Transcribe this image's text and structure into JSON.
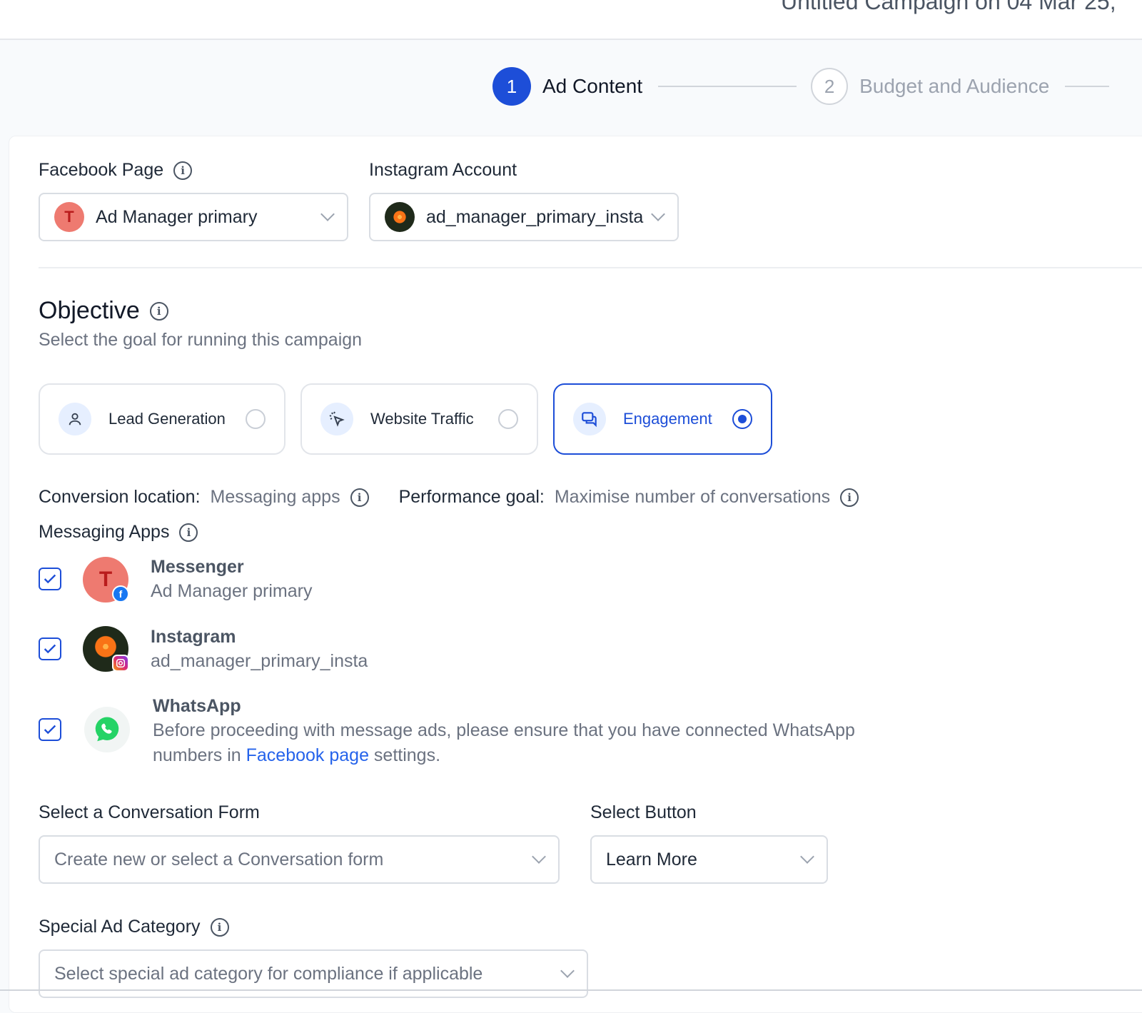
{
  "header": {
    "campaign_title": "Untitled Campaign on 04 Mar 25, "
  },
  "stepper": {
    "steps": [
      {
        "number": "1",
        "label": "Ad Content",
        "state": "active"
      },
      {
        "number": "2",
        "label": "Budget and Audience",
        "state": "inactive"
      }
    ]
  },
  "facebook_page": {
    "label": "Facebook Page",
    "avatar_letter": "T",
    "value": "Ad Manager primary"
  },
  "instagram_account": {
    "label": "Instagram Account",
    "value": "ad_manager_primary_insta"
  },
  "objective": {
    "title": "Objective",
    "subtitle": "Select the goal for running this campaign",
    "options": [
      {
        "label": "Lead Generation",
        "icon": "user-icon",
        "selected": false
      },
      {
        "label": "Website Traffic",
        "icon": "cursor-click-icon",
        "selected": false
      },
      {
        "label": "Engagement",
        "icon": "chat-bubbles-icon",
        "selected": true
      }
    ]
  },
  "conversion": {
    "location_label": "Conversion location:",
    "location_value": "Messaging apps",
    "goal_label": "Performance goal:",
    "goal_value": "Maximise number of conversations"
  },
  "messaging_apps": {
    "label": "Messaging Apps",
    "apps": [
      {
        "name": "Messenger",
        "subtitle": "Ad Manager primary",
        "avatar_letter": "T",
        "checked": true
      },
      {
        "name": "Instagram",
        "subtitle": "ad_manager_primary_insta",
        "checked": true
      },
      {
        "name": "WhatsApp",
        "subtitle_part1": "Before proceeding with message ads, please ensure that you have connected WhatsApp",
        "subtitle_part2": "numbers in ",
        "link_text": "Facebook page",
        "subtitle_part3": " settings.",
        "checked": true
      }
    ]
  },
  "conversation_form": {
    "label": "Select a Conversation Form",
    "placeholder": "Create new or select a Conversation form"
  },
  "select_button": {
    "label": "Select Button",
    "value": "Learn More"
  },
  "special_ad_category": {
    "label": "Special Ad Category",
    "placeholder": "Select special ad category for compliance if applicable"
  },
  "colors": {
    "accent": "#1d4ed8",
    "link": "#2563eb",
    "facebook_badge": "#1877f2",
    "whatsapp": "#25d366"
  }
}
